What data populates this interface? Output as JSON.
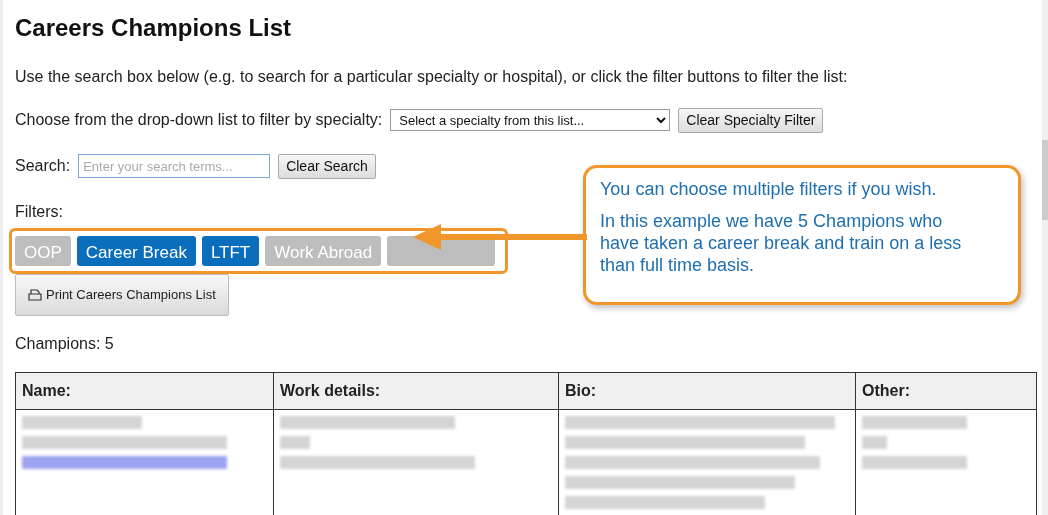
{
  "title": "Careers Champions List",
  "intro": "Use the search box below (e.g. to search for a particular specialty or hospital), or click the filter buttons to filter the list:",
  "specialty": {
    "label": "Choose from the drop-down list to filter by specialty:",
    "select_value": "Select a specialty from this list...",
    "clear_button": "Clear Specialty Filter"
  },
  "search": {
    "label": "Search:",
    "placeholder": "Enter your search terms...",
    "clear_button": "Clear Search"
  },
  "filters": {
    "label": "Filters:",
    "buttons": [
      {
        "label": "OOP",
        "selected": false
      },
      {
        "label": "Career Break",
        "selected": true
      },
      {
        "label": "LTFT",
        "selected": true
      },
      {
        "label": "Work Abroad",
        "selected": false
      },
      {
        "selected": false
      }
    ]
  },
  "print_button": "Print Careers Champions List",
  "count": "Champions: 5",
  "table": {
    "columns": [
      "Name:",
      "Work details:",
      "Bio:",
      "Other:"
    ]
  },
  "callout": {
    "paragraphs": [
      "You can choose multiple filters if you wish.",
      "In this example we have 5 Champions who have taken a career break and train on a less than full time basis."
    ]
  }
}
